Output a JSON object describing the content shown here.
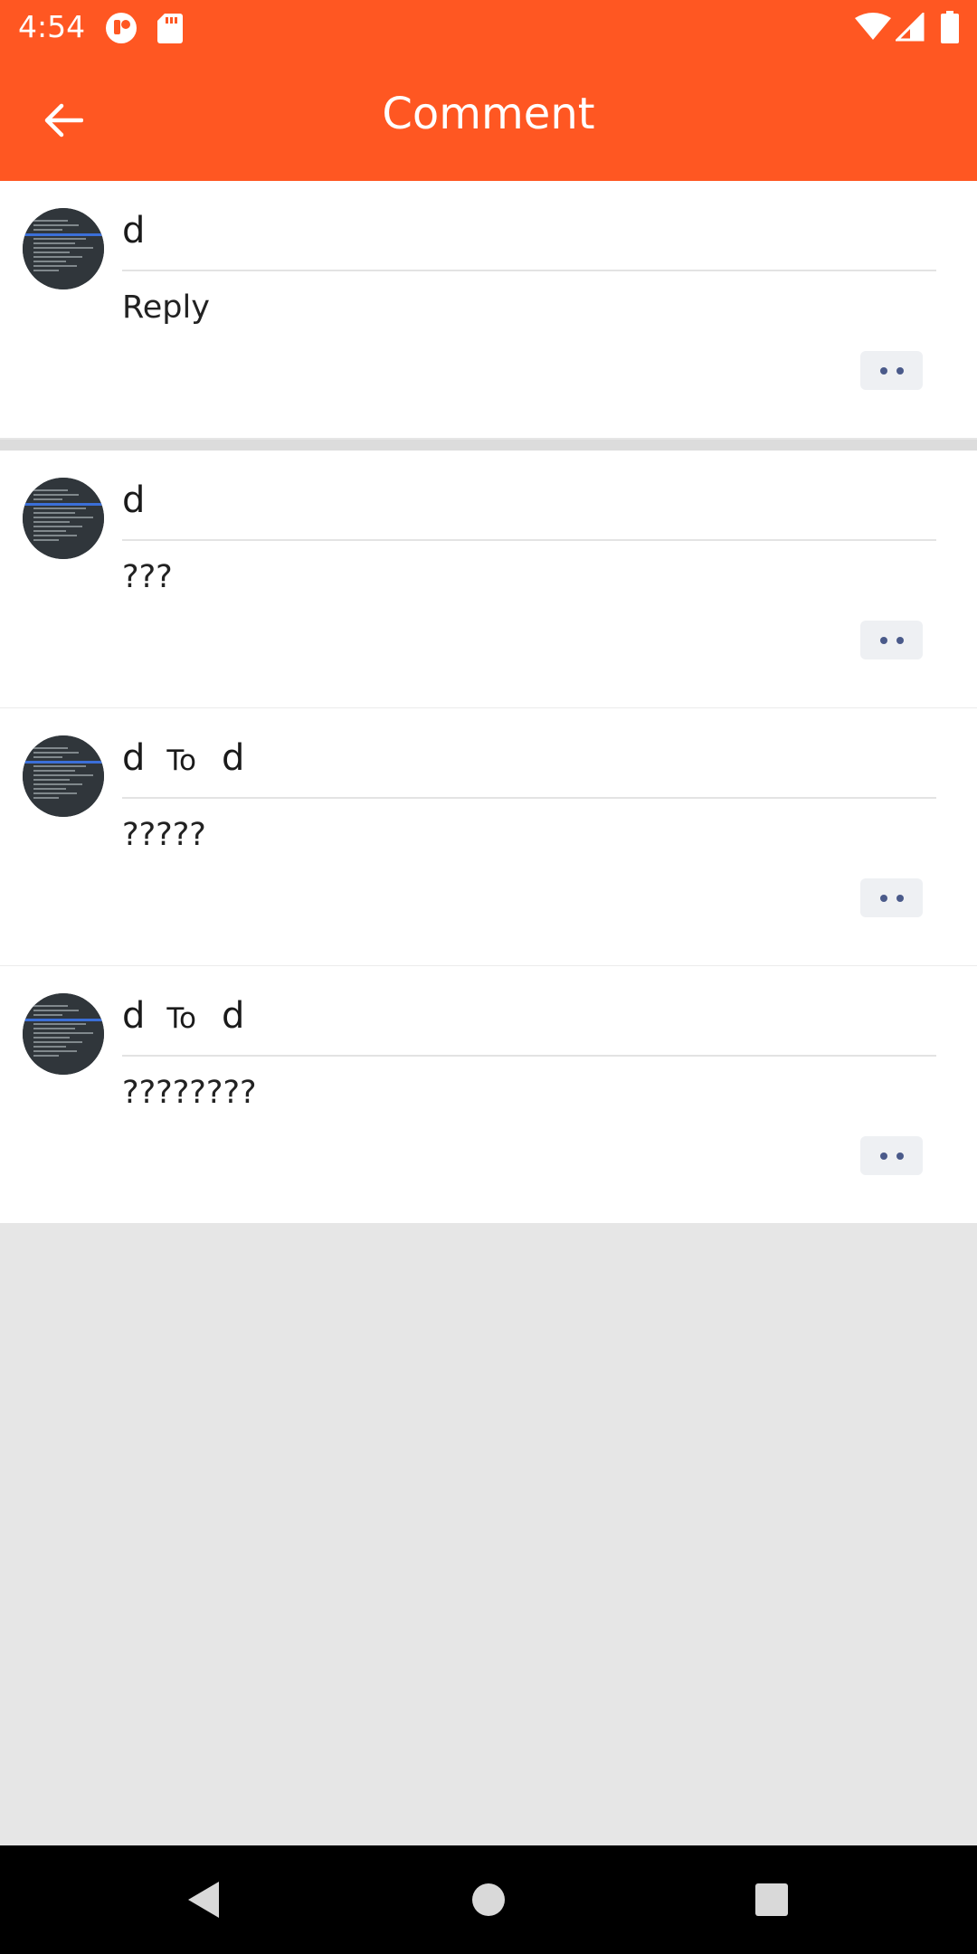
{
  "status_bar": {
    "time": "4:54",
    "icons": [
      "notification-icon",
      "sd-card-icon",
      "wifi-icon",
      "signal-icon",
      "battery-icon"
    ]
  },
  "app_bar": {
    "title": "Comment",
    "back_icon": "arrow-left-icon",
    "background_color": "#ff5722"
  },
  "comments": [
    {
      "author": "d",
      "to_label": "",
      "target": "",
      "text": "Reply"
    },
    {
      "author": "d",
      "to_label": "",
      "target": "",
      "text": "???"
    },
    {
      "author": "d",
      "to_label": "To",
      "target": "d",
      "text": "?????"
    },
    {
      "author": "d",
      "to_label": "To",
      "target": "d",
      "text": "????????"
    }
  ],
  "nav_bar": {
    "icons": [
      "nav-back-icon",
      "nav-home-icon",
      "nav-recents-icon"
    ]
  }
}
